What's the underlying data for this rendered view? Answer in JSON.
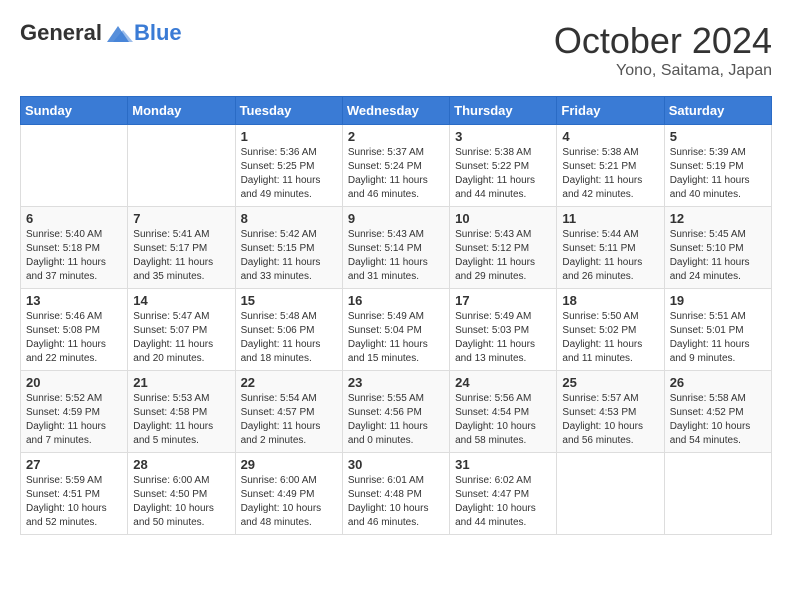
{
  "header": {
    "logo": {
      "general": "General",
      "blue": "Blue"
    },
    "title": "October 2024",
    "location": "Yono, Saitama, Japan"
  },
  "days_of_week": [
    "Sunday",
    "Monday",
    "Tuesday",
    "Wednesday",
    "Thursday",
    "Friday",
    "Saturday"
  ],
  "weeks": [
    [
      {
        "day": null,
        "content": null
      },
      {
        "day": null,
        "content": null
      },
      {
        "day": "1",
        "content": "Sunrise: 5:36 AM\nSunset: 5:25 PM\nDaylight: 11 hours and 49 minutes."
      },
      {
        "day": "2",
        "content": "Sunrise: 5:37 AM\nSunset: 5:24 PM\nDaylight: 11 hours and 46 minutes."
      },
      {
        "day": "3",
        "content": "Sunrise: 5:38 AM\nSunset: 5:22 PM\nDaylight: 11 hours and 44 minutes."
      },
      {
        "day": "4",
        "content": "Sunrise: 5:38 AM\nSunset: 5:21 PM\nDaylight: 11 hours and 42 minutes."
      },
      {
        "day": "5",
        "content": "Sunrise: 5:39 AM\nSunset: 5:19 PM\nDaylight: 11 hours and 40 minutes."
      }
    ],
    [
      {
        "day": "6",
        "content": "Sunrise: 5:40 AM\nSunset: 5:18 PM\nDaylight: 11 hours and 37 minutes."
      },
      {
        "day": "7",
        "content": "Sunrise: 5:41 AM\nSunset: 5:17 PM\nDaylight: 11 hours and 35 minutes."
      },
      {
        "day": "8",
        "content": "Sunrise: 5:42 AM\nSunset: 5:15 PM\nDaylight: 11 hours and 33 minutes."
      },
      {
        "day": "9",
        "content": "Sunrise: 5:43 AM\nSunset: 5:14 PM\nDaylight: 11 hours and 31 minutes."
      },
      {
        "day": "10",
        "content": "Sunrise: 5:43 AM\nSunset: 5:12 PM\nDaylight: 11 hours and 29 minutes."
      },
      {
        "day": "11",
        "content": "Sunrise: 5:44 AM\nSunset: 5:11 PM\nDaylight: 11 hours and 26 minutes."
      },
      {
        "day": "12",
        "content": "Sunrise: 5:45 AM\nSunset: 5:10 PM\nDaylight: 11 hours and 24 minutes."
      }
    ],
    [
      {
        "day": "13",
        "content": "Sunrise: 5:46 AM\nSunset: 5:08 PM\nDaylight: 11 hours and 22 minutes."
      },
      {
        "day": "14",
        "content": "Sunrise: 5:47 AM\nSunset: 5:07 PM\nDaylight: 11 hours and 20 minutes."
      },
      {
        "day": "15",
        "content": "Sunrise: 5:48 AM\nSunset: 5:06 PM\nDaylight: 11 hours and 18 minutes."
      },
      {
        "day": "16",
        "content": "Sunrise: 5:49 AM\nSunset: 5:04 PM\nDaylight: 11 hours and 15 minutes."
      },
      {
        "day": "17",
        "content": "Sunrise: 5:49 AM\nSunset: 5:03 PM\nDaylight: 11 hours and 13 minutes."
      },
      {
        "day": "18",
        "content": "Sunrise: 5:50 AM\nSunset: 5:02 PM\nDaylight: 11 hours and 11 minutes."
      },
      {
        "day": "19",
        "content": "Sunrise: 5:51 AM\nSunset: 5:01 PM\nDaylight: 11 hours and 9 minutes."
      }
    ],
    [
      {
        "day": "20",
        "content": "Sunrise: 5:52 AM\nSunset: 4:59 PM\nDaylight: 11 hours and 7 minutes."
      },
      {
        "day": "21",
        "content": "Sunrise: 5:53 AM\nSunset: 4:58 PM\nDaylight: 11 hours and 5 minutes."
      },
      {
        "day": "22",
        "content": "Sunrise: 5:54 AM\nSunset: 4:57 PM\nDaylight: 11 hours and 2 minutes."
      },
      {
        "day": "23",
        "content": "Sunrise: 5:55 AM\nSunset: 4:56 PM\nDaylight: 11 hours and 0 minutes."
      },
      {
        "day": "24",
        "content": "Sunrise: 5:56 AM\nSunset: 4:54 PM\nDaylight: 10 hours and 58 minutes."
      },
      {
        "day": "25",
        "content": "Sunrise: 5:57 AM\nSunset: 4:53 PM\nDaylight: 10 hours and 56 minutes."
      },
      {
        "day": "26",
        "content": "Sunrise: 5:58 AM\nSunset: 4:52 PM\nDaylight: 10 hours and 54 minutes."
      }
    ],
    [
      {
        "day": "27",
        "content": "Sunrise: 5:59 AM\nSunset: 4:51 PM\nDaylight: 10 hours and 52 minutes."
      },
      {
        "day": "28",
        "content": "Sunrise: 6:00 AM\nSunset: 4:50 PM\nDaylight: 10 hours and 50 minutes."
      },
      {
        "day": "29",
        "content": "Sunrise: 6:00 AM\nSunset: 4:49 PM\nDaylight: 10 hours and 48 minutes."
      },
      {
        "day": "30",
        "content": "Sunrise: 6:01 AM\nSunset: 4:48 PM\nDaylight: 10 hours and 46 minutes."
      },
      {
        "day": "31",
        "content": "Sunrise: 6:02 AM\nSunset: 4:47 PM\nDaylight: 10 hours and 44 minutes."
      },
      {
        "day": null,
        "content": null
      },
      {
        "day": null,
        "content": null
      }
    ]
  ]
}
